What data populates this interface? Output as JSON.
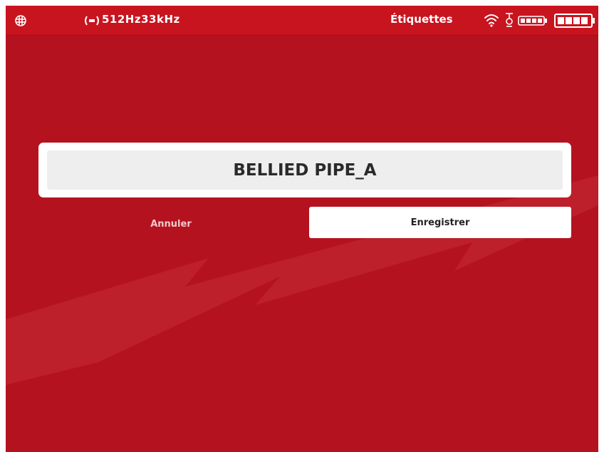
{
  "status_bar": {
    "frequency": "512Hz33kHz",
    "title": "Étiquettes",
    "icons": [
      "grid-icon",
      "signal-icon",
      "wifi-icon",
      "antenna-icon",
      "battery-icon",
      "battery-full-icon"
    ]
  },
  "label_field": {
    "value": "BELLIED PIPE_A"
  },
  "actions": {
    "cancel_label": "Annuler",
    "save_label": "Enregistrer"
  },
  "colors": {
    "background": "#b5121f",
    "status_bar": "#c8141f",
    "card": "#ffffff",
    "field": "#eeeeee"
  }
}
